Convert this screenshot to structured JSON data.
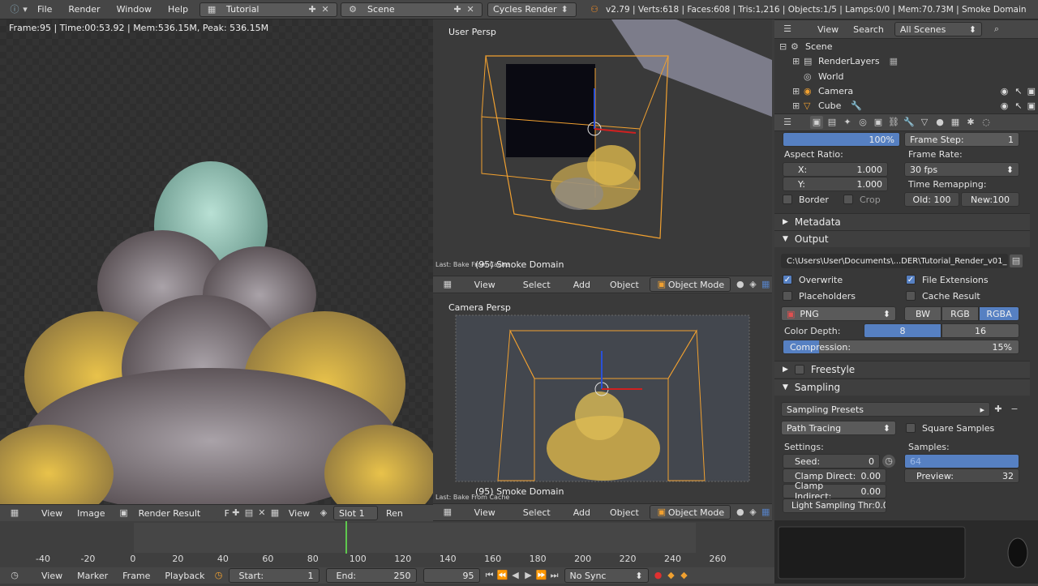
{
  "topbar": {
    "menus": [
      "File",
      "Render",
      "Window",
      "Help"
    ],
    "screen_layout": "Tutorial",
    "scene": "Scene",
    "engine": "Cycles Render",
    "stats": "v2.79 | Verts:618 | Faces:608 | Tris:1,216 | Objects:1/5 | Lamps:0/0 | Mem:70.73M | Smoke Domain"
  },
  "render_view": {
    "info": "Frame:95 | Time:00:53.92 | Mem:536.15M, Peak: 536.15M",
    "header": {
      "view": "View",
      "image": "Image",
      "image_name": "Render Result",
      "f_label": "F",
      "view2": "View",
      "slot": "Slot 1",
      "ren": "Ren"
    }
  },
  "viewport_top": {
    "label": "User Persp",
    "bake_note": "Last: Bake From Cache",
    "object_label": "(95) Smoke Domain",
    "header": {
      "view": "View",
      "select": "Select",
      "add": "Add",
      "object": "Object",
      "mode": "Object Mode"
    }
  },
  "viewport_bottom": {
    "label": "Camera Persp",
    "bake_note": "Last: Bake From Cache",
    "object_label": "(95) Smoke Domain",
    "header": {
      "view": "View",
      "select": "Select",
      "add": "Add",
      "object": "Object",
      "mode": "Object Mode"
    }
  },
  "outliner": {
    "header": {
      "view": "View",
      "search": "Search",
      "scenes": "All Scenes"
    },
    "items": [
      "Scene",
      "RenderLayers",
      "World",
      "Camera",
      "Cube"
    ]
  },
  "properties": {
    "resolution_pct": "100%",
    "frame_step_label": "Frame Step:",
    "frame_step": "1",
    "aspect_label": "Aspect Ratio:",
    "aspect_x_label": "X:",
    "aspect_x": "1.000",
    "aspect_y_label": "Y:",
    "aspect_y": "1.000",
    "frame_rate_label": "Frame Rate:",
    "frame_rate": "30 fps",
    "time_remap_label": "Time Remapping:",
    "old": "Old: 100",
    "new": "New:100",
    "border": "Border",
    "crop": "Crop",
    "metadata": "Metadata",
    "output": "Output",
    "output_path": "C:\\Users\\User\\Documents\\...DER\\Tutorial_Render_v01_",
    "overwrite": "Overwrite",
    "file_ext": "File Extensions",
    "placeholders": "Placeholders",
    "cache_result": "Cache Result",
    "format": "PNG",
    "bw": "BW",
    "rgb": "RGB",
    "rgba": "RGBA",
    "color_depth_label": "Color Depth:",
    "depth_8": "8",
    "depth_16": "16",
    "compression_label": "Compression:",
    "compression": "15%",
    "compression_fraction": 0.15,
    "freestyle": "Freestyle",
    "sampling": "Sampling",
    "sampling_presets": "Sampling Presets",
    "integrator": "Path Tracing",
    "square_samples": "Square Samples",
    "settings_label": "Settings:",
    "samples_label": "Samples:",
    "seed_label": "Seed:",
    "seed": "0",
    "render_samples": "64",
    "clamp_direct_label": "Clamp Direct:",
    "clamp_direct": "0.00",
    "preview_label": "Preview:",
    "preview": "32",
    "clamp_indirect_label": "Clamp Indirect:",
    "clamp_indirect": "0.00",
    "light_threshold": "Light Sampling Thr:0.01"
  },
  "timeline": {
    "ticks": [
      "-40",
      "-20",
      "0",
      "20",
      "40",
      "60",
      "80",
      "100",
      "120",
      "140",
      "160",
      "180",
      "200",
      "220",
      "240",
      "260"
    ],
    "current_frame": 95
  },
  "bottombar": {
    "view": "View",
    "marker": "Marker",
    "frame": "Frame",
    "playback": "Playback",
    "start_label": "Start:",
    "start": "1",
    "end_label": "End:",
    "end": "250",
    "current": "95",
    "sync": "No Sync"
  },
  "colors": {
    "accent": "#5680c2",
    "selected_orange": "#f0a030",
    "bg": "#393939"
  }
}
